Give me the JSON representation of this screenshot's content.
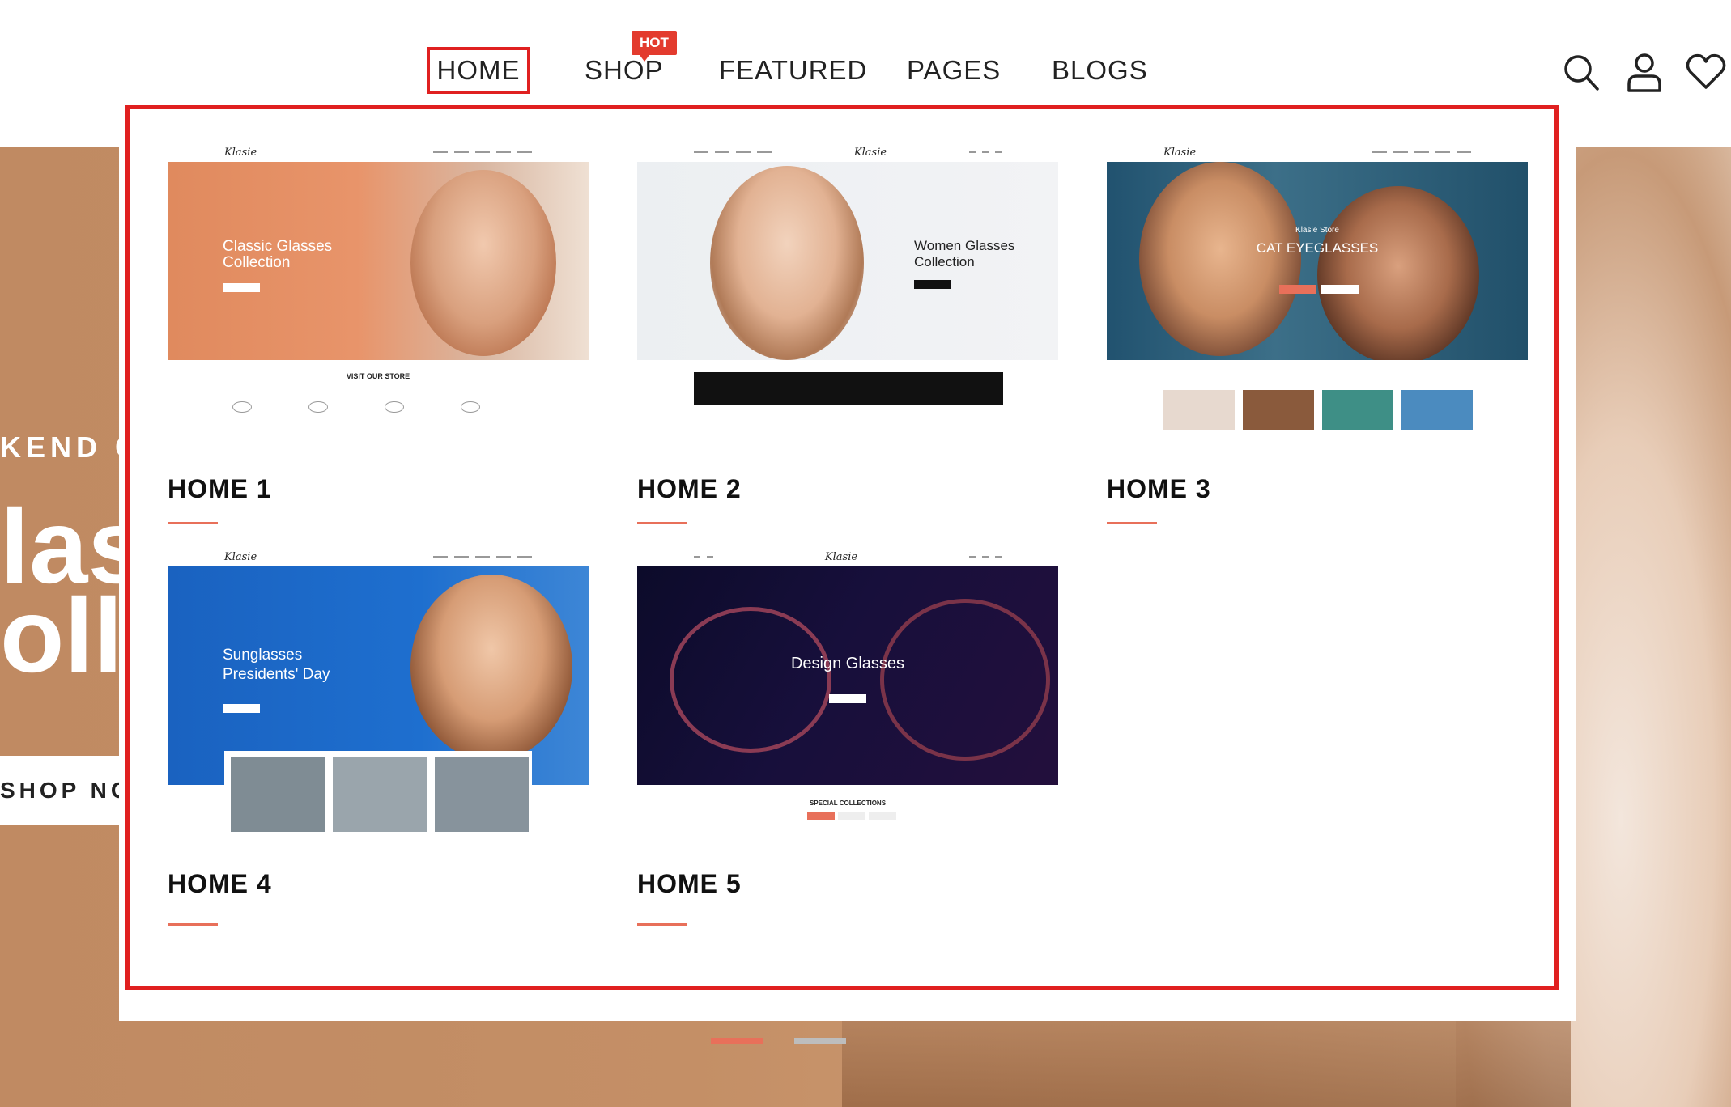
{
  "nav": {
    "items": [
      "HOME",
      "SHOP",
      "FEATURED",
      "PAGES",
      "BLOGS"
    ],
    "active": "HOME",
    "hot_badge": "HOT"
  },
  "header_icons": [
    "search-icon",
    "user-icon",
    "heart-icon"
  ],
  "hero": {
    "kicker": "KEND O",
    "title_line1": "lass",
    "title_line2": "olle",
    "button": "SHOP NO"
  },
  "demos": [
    {
      "label": "HOME 1",
      "logo": "Klasie",
      "hero_text_line1": "Classic Glasses",
      "hero_text_line2": "Collection",
      "section_title": "VISIT OUR STORE"
    },
    {
      "label": "HOME 2",
      "logo": "Klasie",
      "hero_text_line1": "Women Glasses",
      "hero_text_line2": "Collection"
    },
    {
      "label": "HOME 3",
      "logo": "Klasie",
      "hero_kicker": "Klasie Store",
      "hero_text_line1": "CAT EYEGLASSES"
    },
    {
      "label": "HOME 4",
      "logo": "Klasie",
      "hero_text_line1": "Sunglasses",
      "hero_text_line2": "Presidents' Day"
    },
    {
      "label": "HOME 5",
      "logo": "Klasie",
      "hero_text_line1": "Design Glasses",
      "section_title": "SPECIAL COLLECTIONS"
    }
  ],
  "colors": {
    "accent": "#e8705a",
    "highlight_border": "#e02020",
    "hot_badge": "#e33b2e"
  }
}
